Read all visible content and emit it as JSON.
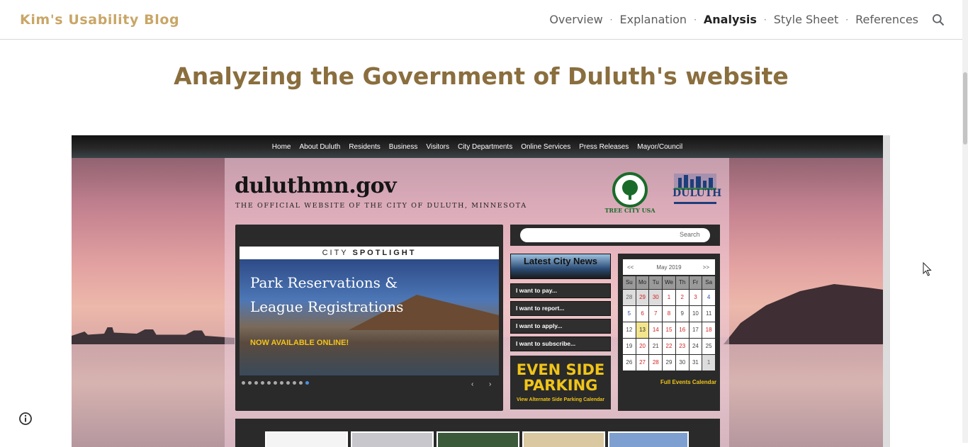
{
  "blog": {
    "title": "Kim's Usability Blog",
    "nav": [
      {
        "label": "Overview",
        "active": false
      },
      {
        "label": "Explanation",
        "active": false
      },
      {
        "label": "Analysis",
        "active": true
      },
      {
        "label": "Style Sheet",
        "active": false
      },
      {
        "label": "References",
        "active": false
      }
    ],
    "nav_separator": "·",
    "search_icon": "search-icon",
    "accent_color": "#c9a667",
    "title_color": "#8a6e3e"
  },
  "page": {
    "heading": "Analyzing the Government of Duluth's website"
  },
  "screenshot": {
    "nav": [
      "Home",
      "About Duluth",
      "Residents",
      "Business",
      "Visitors",
      "City Departments",
      "Online Services",
      "Press Releases",
      "Mayor/Council"
    ],
    "site_name": "duluthmn.gov",
    "tagline": "THE OFFICIAL WEBSITE OF THE CITY OF DULUTH, MINNESOTA",
    "tree_city_caption": "TREE CITY USA",
    "duluth_logo_word": "DULUTH",
    "spotlight": {
      "label_prefix": "CITY ",
      "label_bold": "SPOTLIGHT",
      "line1": "Park Reservations &",
      "line2": "League Registrations",
      "cta": "NOW AVAILABLE ONLINE!",
      "slides": 11,
      "active_slide": 11,
      "prev": "‹",
      "next": "›"
    },
    "search_placeholder": "Search",
    "latest_news": "Latest City News",
    "want_links": [
      "I want to pay...",
      "I want to report...",
      "I want to apply...",
      "I want to subscribe..."
    ],
    "parking": {
      "line1": "EVEN SIDE",
      "line2": "PARKING",
      "link": "View Alternate Side Parking Calendar"
    },
    "calendar": {
      "prev": "<<",
      "month": "May 2019",
      "next": ">>",
      "day_names": [
        "Su",
        "Mo",
        "Tu",
        "We",
        "Th",
        "Fr",
        "Sa"
      ],
      "weeks": [
        [
          "28",
          "29",
          "30",
          "1",
          "2",
          "3",
          "4"
        ],
        [
          "5",
          "6",
          "7",
          "8",
          "9",
          "10",
          "11"
        ],
        [
          "12",
          "13",
          "14",
          "15",
          "16",
          "17",
          "18"
        ],
        [
          "19",
          "20",
          "21",
          "22",
          "23",
          "24",
          "25"
        ],
        [
          "26",
          "27",
          "28",
          "29",
          "30",
          "31",
          "1"
        ]
      ],
      "link": "Full Events Calendar"
    }
  },
  "footer": {
    "info_icon": "info-icon"
  }
}
